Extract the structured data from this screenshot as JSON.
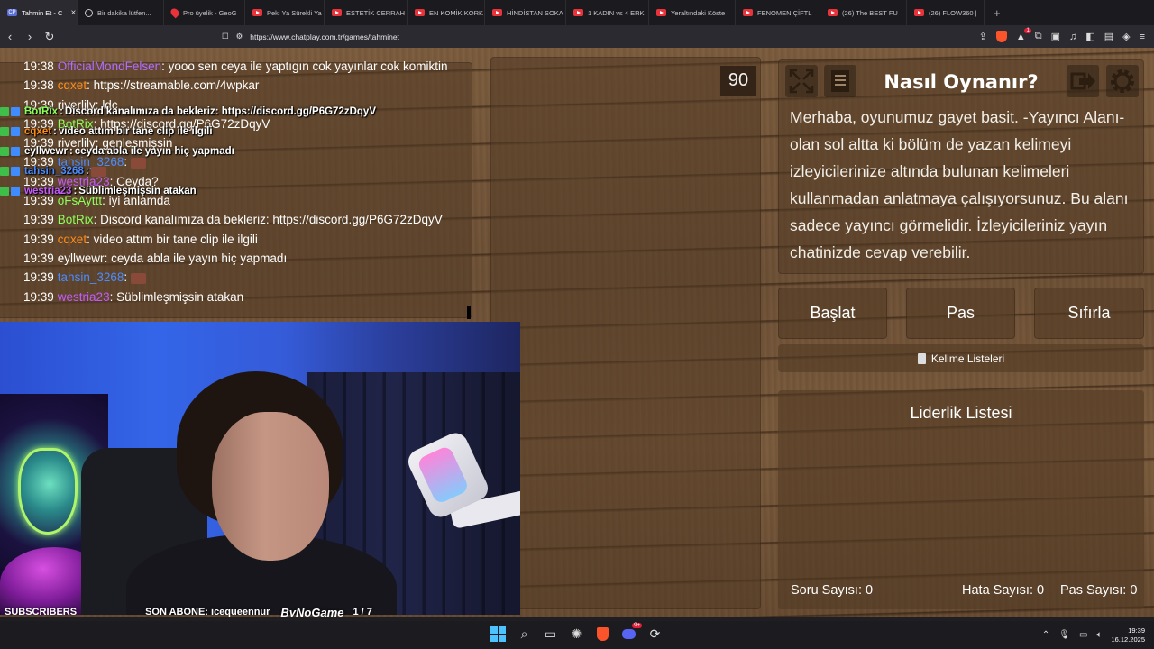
{
  "browser": {
    "tabs": [
      {
        "icon": "chatplay-icon",
        "label": "Tahmin Et - C",
        "active": true
      },
      {
        "icon": "globe-icon",
        "label": "Bir dakika lütfen..."
      },
      {
        "icon": "pin-icon",
        "label": "Pro üyelik - GeoG"
      },
      {
        "icon": "youtube-icon",
        "label": "Peki Ya Sürekli Ya"
      },
      {
        "icon": "youtube-icon",
        "label": "ESTETİK CERRAH"
      },
      {
        "icon": "youtube-icon",
        "label": "EN KOMİK KORK"
      },
      {
        "icon": "youtube-icon",
        "label": "HİNDİSTAN SOKA"
      },
      {
        "icon": "youtube-icon",
        "label": "1 KADIN vs 4 ERK"
      },
      {
        "icon": "youtube-icon",
        "label": "Yeraltındaki Köste"
      },
      {
        "icon": "youtube-icon",
        "label": "FENOMEN ÇİFTL"
      },
      {
        "icon": "youtube-icon",
        "label": "(26) The BEST FU"
      },
      {
        "icon": "youtube-icon",
        "label": "(26) FLOW360 | "
      }
    ],
    "new_tab": "+",
    "url": "https://www.chatplay.com.tr/games/tahminet",
    "shield_badge": "",
    "alert_badge": "1"
  },
  "game": {
    "timer": "90",
    "howto_title": "Nasıl Oynanır?",
    "howto_text": "Merhaba, oyunumuz gayet basit. -Yayıncı Alanı- olan sol altta ki bölüm de yazan kelimeyi izleyicilerinize altında bulunan kelimeleri kullanmadan anlatmaya çalışıyorsunuz. Bu alanı sadece yayıncı görmelidir. İzleyicileriniz yayın chatinizde cevap verebilir.",
    "buttons": {
      "start": "Başlat",
      "pass": "Pas",
      "reset": "Sıfırla"
    },
    "word_lists": "Kelime Listeleri",
    "leaderboard_title": "Liderlik Listesi",
    "stats": {
      "questions_label": "Soru Sayısı:",
      "questions": "0",
      "errors_label": "Hata Sayısı:",
      "errors": "0",
      "passes_label": "Pas Sayısı:",
      "passes": "0"
    }
  },
  "chat": [
    {
      "time": "19:38",
      "user": "OfficialMondFelsen",
      "color": "#b06cff",
      "msg": "yooo sen ceya ile yaptıgın cok yayınlar cok komiktin"
    },
    {
      "time": "19:38",
      "user": "cqxet",
      "color": "#ff8c1a",
      "msg": "https://streamable.com/4wpkar"
    },
    {
      "time": "19:39",
      "user": "riverlily",
      "color": "#ffffff",
      "msg": "ldc"
    },
    {
      "time": "19:39",
      "user": "BotRix",
      "color": "#8dff5a",
      "msg": "https://discord.gg/P6G72zDqyV"
    },
    {
      "time": "19:39",
      "user": "riverlily",
      "color": "#ffffff",
      "msg": "genleşmişsin"
    },
    {
      "time": "19:39",
      "user": "tahsin_3268",
      "color": "#4a8cff",
      "msg": ""
    },
    {
      "time": "19:39",
      "user": "westria23",
      "color": "#c45bff",
      "msg": "Ceyda?"
    },
    {
      "time": "19:39",
      "user": "oFsAyttt",
      "color": "#8dff5a",
      "msg": "iyi anlamda"
    },
    {
      "time": "19:39",
      "user": "BotRix",
      "color": "#8dff5a",
      "msg": "Discord kanalımıza da bekleriz: https://discord.gg/P6G72zDqyV"
    },
    {
      "time": "19:39",
      "user": "cqxet",
      "color": "#ff8c1a",
      "msg": "video attım bir tane clip ile ilgili"
    },
    {
      "time": "19:39",
      "user": "eyllwewr",
      "color": "#ffffff",
      "msg": "ceyda abla ile yayın hiç yapmadı"
    },
    {
      "time": "19:39",
      "user": "tahsin_3268",
      "color": "#4a8cff",
      "msg": ""
    },
    {
      "time": "19:39",
      "user": "westria23",
      "color": "#c45bff",
      "msg": "Süblimleşmişsin atakan"
    }
  ],
  "overlay_chat": [
    {
      "user": "BotRix",
      "color": "#8dff5a",
      "msg": "Discord kanalımıza da bekleriz: https://discord.gg/P6G72zDqyV"
    },
    {
      "user": "cqxet",
      "color": "#ff8c1a",
      "msg": "video attım bir tane clip ile ilgili"
    },
    {
      "user": "eyllwewr",
      "color": "#ffffff",
      "msg": "ceyda abla ile yayın hiç yapmadı"
    },
    {
      "user": "tahsin_3268",
      "color": "#4a8cff",
      "msg": ""
    },
    {
      "user": "westria23",
      "color": "#c45bff",
      "msg": "Süblimleşmişsin atakan"
    }
  ],
  "stream": {
    "subscribers_label": "SUBSCRIBERS",
    "last_sub": "SON ABONE: icequeennur",
    "brand": "ByNoGame",
    "counter": "1 / 7",
    "progress": 0.14
  },
  "taskbar": {
    "time": "19:39",
    "date": "16.12.2025",
    "discord_badge": "9+"
  }
}
